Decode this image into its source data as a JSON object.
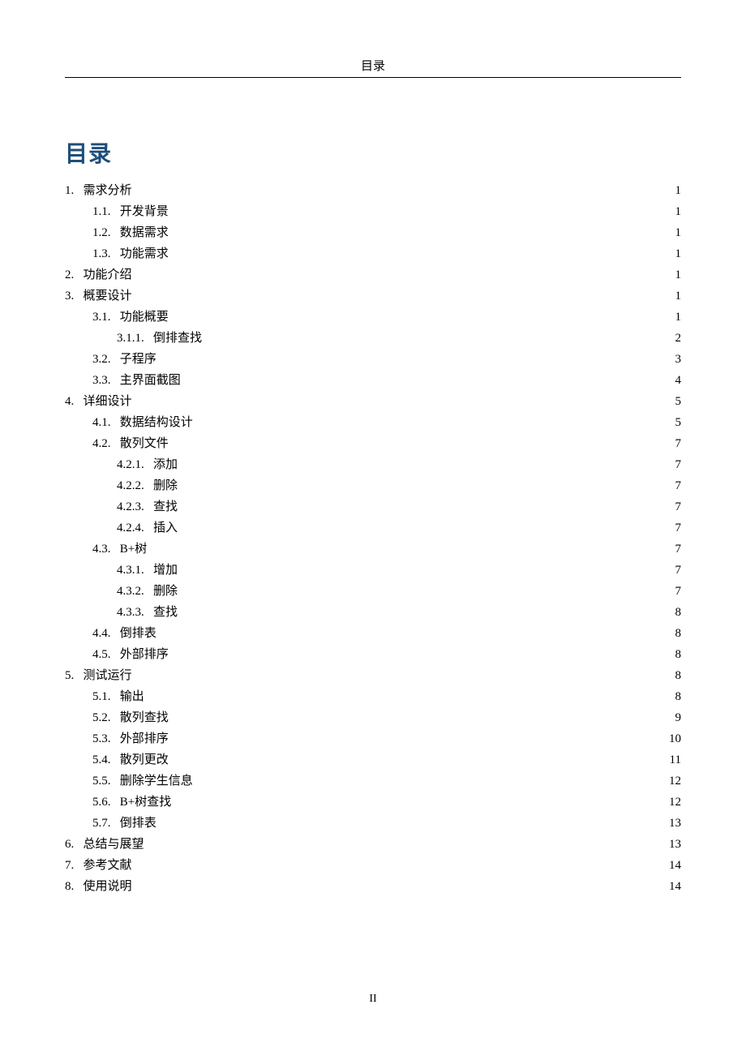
{
  "header": {
    "label": "目录"
  },
  "title": "目录",
  "footer": {
    "page_number": "II"
  },
  "toc": [
    {
      "indent": 0,
      "num": "1.",
      "gap": "   ",
      "text": "需求分析",
      "page": "1"
    },
    {
      "indent": 1,
      "num": "1.1.",
      "gap": "   ",
      "text": "开发背景",
      "page": "1"
    },
    {
      "indent": 1,
      "num": "1.2.",
      "gap": "   ",
      "text": "数据需求",
      "page": "1"
    },
    {
      "indent": 1,
      "num": "1.3.",
      "gap": "   ",
      "text": "功能需求",
      "page": "1"
    },
    {
      "indent": 0,
      "num": "2.",
      "gap": "   ",
      "text": "功能介绍",
      "page": "1"
    },
    {
      "indent": 0,
      "num": "3.",
      "gap": "   ",
      "text": "概要设计",
      "page": "1"
    },
    {
      "indent": 1,
      "num": "3.1.",
      "gap": "   ",
      "text": "功能概要",
      "page": "1"
    },
    {
      "indent": 2,
      "num": "3.1.1.",
      "gap": "   ",
      "text": "倒排查找",
      "page": "2"
    },
    {
      "indent": 1,
      "num": "3.2.",
      "gap": "   ",
      "text": "子程序",
      "page": "3"
    },
    {
      "indent": 1,
      "num": "3.3.",
      "gap": "   ",
      "text": "主界面截图",
      "page": "4"
    },
    {
      "indent": 0,
      "num": "4.",
      "gap": "   ",
      "text": "详细设计",
      "page": "5"
    },
    {
      "indent": 1,
      "num": "4.1.",
      "gap": "   ",
      "text": "数据结构设计",
      "page": "5"
    },
    {
      "indent": 1,
      "num": "4.2.",
      "gap": "   ",
      "text": "散列文件",
      "page": "7"
    },
    {
      "indent": 2,
      "num": "4.2.1.",
      "gap": "   ",
      "text": "添加",
      "page": "7"
    },
    {
      "indent": 2,
      "num": "4.2.2.",
      "gap": "   ",
      "text": "删除",
      "page": "7"
    },
    {
      "indent": 2,
      "num": "4.2.3.",
      "gap": "   ",
      "text": "查找",
      "page": "7"
    },
    {
      "indent": 2,
      "num": "4.2.4.",
      "gap": "   ",
      "text": "插入",
      "page": "7"
    },
    {
      "indent": 1,
      "num": "4.3.",
      "gap": "   ",
      "text": "B+树",
      "page": "7"
    },
    {
      "indent": 2,
      "num": "4.3.1.",
      "gap": "   ",
      "text": "增加",
      "page": "7"
    },
    {
      "indent": 2,
      "num": "4.3.2.",
      "gap": "   ",
      "text": "删除",
      "page": "7"
    },
    {
      "indent": 2,
      "num": "4.3.3.",
      "gap": "   ",
      "text": "查找",
      "page": "8"
    },
    {
      "indent": 1,
      "num": "4.4.",
      "gap": "   ",
      "text": "倒排表",
      "page": "8"
    },
    {
      "indent": 1,
      "num": "4.5.",
      "gap": "   ",
      "text": "外部排序",
      "page": "8"
    },
    {
      "indent": 0,
      "num": "5.",
      "gap": "   ",
      "text": "测试运行",
      "page": "8"
    },
    {
      "indent": 1,
      "num": "5.1.",
      "gap": "   ",
      "text": "输出",
      "page": "8"
    },
    {
      "indent": 1,
      "num": "5.2.",
      "gap": "   ",
      "text": "散列查找",
      "page": "9"
    },
    {
      "indent": 1,
      "num": "5.3.",
      "gap": "   ",
      "text": "外部排序",
      "page": "10"
    },
    {
      "indent": 1,
      "num": "5.4.",
      "gap": "   ",
      "text": "散列更改",
      "page": "11"
    },
    {
      "indent": 1,
      "num": "5.5.",
      "gap": "   ",
      "text": "删除学生信息",
      "page": "12"
    },
    {
      "indent": 1,
      "num": "5.6.",
      "gap": "   ",
      "text": "B+树查找",
      "page": "12"
    },
    {
      "indent": 1,
      "num": "5.7.",
      "gap": "   ",
      "text": "倒排表",
      "page": "13"
    },
    {
      "indent": 0,
      "num": "6.",
      "gap": "   ",
      "text": "总结与展望",
      "page": "13"
    },
    {
      "indent": 0,
      "num": "7.",
      "gap": "   ",
      "text": "参考文献",
      "page": "14"
    },
    {
      "indent": 0,
      "num": "8.",
      "gap": "   ",
      "text": "使用说明",
      "page": "14"
    }
  ]
}
